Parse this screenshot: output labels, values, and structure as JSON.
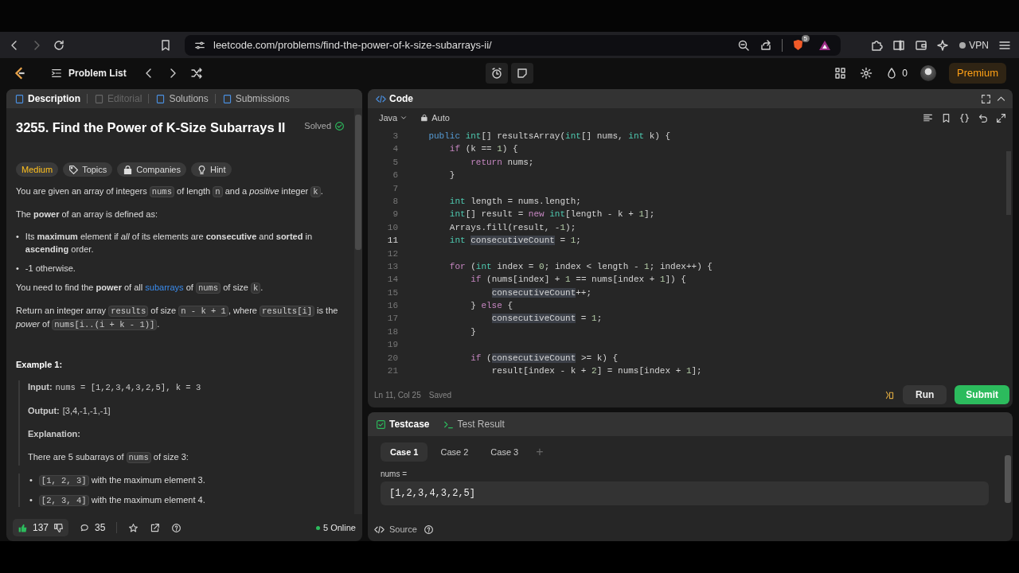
{
  "browser": {
    "url": "leetcode.com/problems/find-the-power-of-k-size-subarrays-ii/",
    "shield_badge": "5",
    "vpn": "VPN"
  },
  "header": {
    "problem_list": "Problem List",
    "streak": "0",
    "premium": "Premium"
  },
  "description_tabs": [
    {
      "label": "Description",
      "selected": true,
      "disabled": false
    },
    {
      "label": "Editorial",
      "selected": false,
      "disabled": true
    },
    {
      "label": "Solutions",
      "selected": false,
      "disabled": false
    },
    {
      "label": "Submissions",
      "selected": false,
      "disabled": false
    }
  ],
  "problem": {
    "title": "3255. Find the Power of K-Size Subarrays II",
    "status": "Solved",
    "tags": [
      {
        "label": "Medium",
        "kind": "difficulty"
      },
      {
        "label": "Topics",
        "kind": "topics"
      },
      {
        "label": "Companies",
        "kind": "companies"
      },
      {
        "label": "Hint",
        "kind": "hint"
      }
    ],
    "blocks": [
      {
        "kind": "paragraph",
        "inset": false,
        "segments": [
          {
            "kind": "text",
            "text": "You are given an array of integers "
          },
          {
            "kind": "code",
            "text": "nums"
          },
          {
            "kind": "text",
            "text": " of length "
          },
          {
            "kind": "code",
            "text": "n"
          },
          {
            "kind": "text",
            "text": " and a *positive* integer "
          },
          {
            "kind": "code",
            "text": "k"
          },
          {
            "kind": "text",
            "text": "."
          }
        ]
      },
      {
        "kind": "paragraph",
        "inset": false,
        "segments": [
          {
            "kind": "text",
            "text": "The **power** of an array is defined as:"
          }
        ]
      },
      {
        "kind": "list",
        "inset": false,
        "items": [
          {
            "marker": "•",
            "segments": [
              {
                "kind": "text",
                "text": "Its **maximum** element if *all* of its elements are **consecutive** and **sorted** in **ascending** order."
              }
            ]
          },
          {
            "marker": "•",
            "segments": [
              {
                "kind": "text",
                "text": "-1 otherwise."
              }
            ]
          }
        ]
      },
      {
        "kind": "paragraph",
        "inset": false,
        "segments": [
          {
            "kind": "text",
            "text": "You need to find the **power** of all "
          },
          {
            "kind": "link",
            "text": "subarrays"
          },
          {
            "kind": "text",
            "text": " of "
          },
          {
            "kind": "code",
            "text": "nums"
          },
          {
            "kind": "text",
            "text": " of size "
          },
          {
            "kind": "code",
            "text": "k"
          },
          {
            "kind": "text",
            "text": "."
          }
        ]
      },
      {
        "kind": "paragraph",
        "inset": false,
        "segments": [
          {
            "kind": "text",
            "text": "Return an integer array "
          },
          {
            "kind": "code",
            "text": "results"
          },
          {
            "kind": "text",
            "text": " of size "
          },
          {
            "kind": "code",
            "text": "n - k + 1"
          },
          {
            "kind": "text",
            "text": ", where "
          },
          {
            "kind": "code",
            "text": "results[i]"
          },
          {
            "kind": "text",
            "text": " is the *power* of "
          },
          {
            "kind": "code",
            "text": "nums[i..(i + k - 1)]"
          },
          {
            "kind": "text",
            "text": "."
          }
        ]
      },
      {
        "kind": "heading",
        "inset": false,
        "text": "Example 1:"
      },
      {
        "kind": "field",
        "inset": true,
        "label": "Input:",
        "value": "nums = [1,2,3,4,3,2,5], k = 3",
        "mono": true
      },
      {
        "kind": "field",
        "inset": true,
        "label": "Output:",
        "value": "[3,4,-1,-1,-1]",
        "mono": false
      },
      {
        "kind": "field",
        "inset": true,
        "label": "Explanation:"
      },
      {
        "kind": "paragraph",
        "inset": true,
        "segments": [
          {
            "kind": "text",
            "text": "There are 5 subarrays of "
          },
          {
            "kind": "code",
            "text": "nums"
          },
          {
            "kind": "text",
            "text": " of size 3:"
          }
        ]
      },
      {
        "kind": "list",
        "inset": true,
        "items": [
          {
            "marker": "•",
            "segments": [
              {
                "kind": "code",
                "text": "[1, 2, 3]"
              },
              {
                "kind": "text",
                "text": " with the maximum element 3."
              }
            ]
          },
          {
            "marker": "•",
            "segments": [
              {
                "kind": "code",
                "text": "[2, 3, 4]"
              },
              {
                "kind": "text",
                "text": " with the maximum element 4."
              }
            ]
          }
        ]
      }
    ]
  },
  "description_footer": {
    "likes": "137",
    "comments": "35",
    "online": "5 Online"
  },
  "editor": {
    "tab": "Code",
    "language": "Java",
    "mode": "Auto",
    "lines": [
      {
        "num": "3",
        "current": false,
        "tokens": [
          {
            "kind": "keyword",
            "text": "    public "
          },
          {
            "kind": "type",
            "text": "int"
          },
          {
            "kind": "plain",
            "text": "[] resultsArray("
          },
          {
            "kind": "type",
            "text": "int"
          },
          {
            "kind": "plain",
            "text": "[] nums, "
          },
          {
            "kind": "type",
            "text": "int"
          },
          {
            "kind": "plain",
            "text": " k) {"
          }
        ]
      },
      {
        "num": "4",
        "current": false,
        "tokens": [
          {
            "kind": "control",
            "text": "        if"
          },
          {
            "kind": "plain",
            "text": " (k == "
          },
          {
            "kind": "number",
            "text": "1"
          },
          {
            "kind": "plain",
            "text": ") {"
          }
        ]
      },
      {
        "num": "5",
        "current": false,
        "tokens": [
          {
            "kind": "control",
            "text": "            return"
          },
          {
            "kind": "plain",
            "text": " nums;"
          }
        ]
      },
      {
        "num": "6",
        "current": false,
        "tokens": [
          {
            "kind": "plain",
            "text": "        }"
          }
        ]
      },
      {
        "num": "7",
        "current": false
      },
      {
        "num": "8",
        "current": false,
        "tokens": [
          {
            "kind": "type",
            "text": "        int"
          },
          {
            "kind": "plain",
            "text": " length = nums.length;"
          }
        ]
      },
      {
        "num": "9",
        "current": false,
        "tokens": [
          {
            "kind": "type",
            "text": "        int"
          },
          {
            "kind": "plain",
            "text": "[] result = "
          },
          {
            "kind": "control",
            "text": "new "
          },
          {
            "kind": "type",
            "text": "int"
          },
          {
            "kind": "plain",
            "text": "[length - k + "
          },
          {
            "kind": "number",
            "text": "1"
          },
          {
            "kind": "plain",
            "text": "];"
          }
        ]
      },
      {
        "num": "10",
        "current": false,
        "tokens": [
          {
            "kind": "plain",
            "text": "        Arrays.fill(result, -"
          },
          {
            "kind": "number",
            "text": "1"
          },
          {
            "kind": "plain",
            "text": ");"
          }
        ]
      },
      {
        "num": "11",
        "current": true,
        "tokens": [
          {
            "kind": "type",
            "text": "        int "
          },
          {
            "kind": "occurrence",
            "text": "consecutiveCount"
          },
          {
            "kind": "plain",
            "text": " = "
          },
          {
            "kind": "number",
            "text": "1"
          },
          {
            "kind": "plain",
            "text": ";"
          }
        ]
      },
      {
        "num": "12",
        "current": false
      },
      {
        "num": "13",
        "current": false,
        "tokens": [
          {
            "kind": "control",
            "text": "        for"
          },
          {
            "kind": "plain",
            "text": " ("
          },
          {
            "kind": "type",
            "text": "int"
          },
          {
            "kind": "plain",
            "text": " index = "
          },
          {
            "kind": "number",
            "text": "0"
          },
          {
            "kind": "plain",
            "text": "; index < length - "
          },
          {
            "kind": "number",
            "text": "1"
          },
          {
            "kind": "plain",
            "text": "; index++) {"
          }
        ]
      },
      {
        "num": "14",
        "current": false,
        "tokens": [
          {
            "kind": "control",
            "text": "            if"
          },
          {
            "kind": "plain",
            "text": " (nums[index] + "
          },
          {
            "kind": "number",
            "text": "1"
          },
          {
            "kind": "plain",
            "text": " == nums[index + "
          },
          {
            "kind": "number",
            "text": "1"
          },
          {
            "kind": "plain",
            "text": "]) {"
          }
        ]
      },
      {
        "num": "15",
        "current": false,
        "tokens": [
          {
            "kind": "occurrence",
            "text": "                consecutiveCount"
          },
          {
            "kind": "plain",
            "text": "++;"
          }
        ]
      },
      {
        "num": "16",
        "current": false,
        "tokens": [
          {
            "kind": "plain",
            "text": "            } "
          },
          {
            "kind": "control",
            "text": "else"
          },
          {
            "kind": "plain",
            "text": " {"
          }
        ]
      },
      {
        "num": "17",
        "current": false,
        "tokens": [
          {
            "kind": "occurrence",
            "text": "                consecutiveCount"
          },
          {
            "kind": "plain",
            "text": " = "
          },
          {
            "kind": "number",
            "text": "1"
          },
          {
            "kind": "plain",
            "text": ";"
          }
        ]
      },
      {
        "num": "18",
        "current": false,
        "tokens": [
          {
            "kind": "plain",
            "text": "            }"
          }
        ]
      },
      {
        "num": "19",
        "current": false
      },
      {
        "num": "20",
        "current": false,
        "tokens": [
          {
            "kind": "control",
            "text": "            if"
          },
          {
            "kind": "plain",
            "text": " ("
          },
          {
            "kind": "occurrence",
            "text": "consecutiveCount"
          },
          {
            "kind": "plain",
            "text": " >= k) {"
          }
        ]
      },
      {
        "num": "21",
        "current": false,
        "tokens": [
          {
            "kind": "plain",
            "text": "                result[index - k + "
          },
          {
            "kind": "number",
            "text": "2"
          },
          {
            "kind": "plain",
            "text": "] = nums[index + "
          },
          {
            "kind": "number",
            "text": "1"
          },
          {
            "kind": "plain",
            "text": "];"
          }
        ]
      }
    ],
    "cursor": "Ln 11, Col 25",
    "save_state": "Saved",
    "run": "Run",
    "submit": "Submit"
  },
  "testcase": {
    "tabs": [
      {
        "label": "Testcase",
        "selected": true
      },
      {
        "label": "Test Result",
        "selected": false
      }
    ],
    "cases": [
      {
        "label": "Case 1",
        "selected": true
      },
      {
        "label": "Case 2",
        "selected": false
      },
      {
        "label": "Case 3",
        "selected": false
      }
    ],
    "add": "+",
    "param": "nums =",
    "value": "[1,2,3,4,3,2,5]",
    "source": "Source"
  }
}
